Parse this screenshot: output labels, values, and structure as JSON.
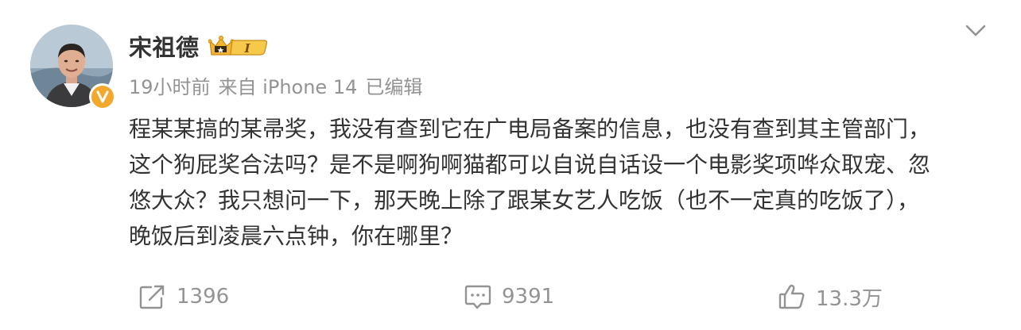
{
  "post": {
    "author": {
      "name": "宋祖德",
      "vip_level": "I"
    },
    "meta": {
      "time": "19小时前",
      "source": "来自 iPhone 14",
      "edited": "已编辑"
    },
    "content_lines": [
      "程某某搞的某帚奖，我没有查到它在广电局备案的信息，也没有查到其主管部门，",
      "这个狗屁奖合法吗？是不是啊狗啊猫都可以自说自话设一个电影奖项哗众取宠、忽",
      "悠大众？我只想问一下，那天晚上除了跟某女艺人吃饭（也不一定真的吃饭了），",
      "晚饭后到凌晨六点钟，你在哪里？"
    ],
    "actions": {
      "repost_count": "1396",
      "comment_count": "9391",
      "like_count": "13.3万"
    }
  },
  "colors": {
    "text_primary": "#333333",
    "text_secondary": "#939393",
    "verified_orange": "#f3a82c",
    "vip_gold": "#f2b632"
  },
  "icons": {
    "repost": "repost-icon",
    "comment": "comment-icon",
    "like": "thumbs-up-icon",
    "more": "chevron-down-icon",
    "verified": "verified-badge-icon",
    "vip": "crown-icon"
  }
}
